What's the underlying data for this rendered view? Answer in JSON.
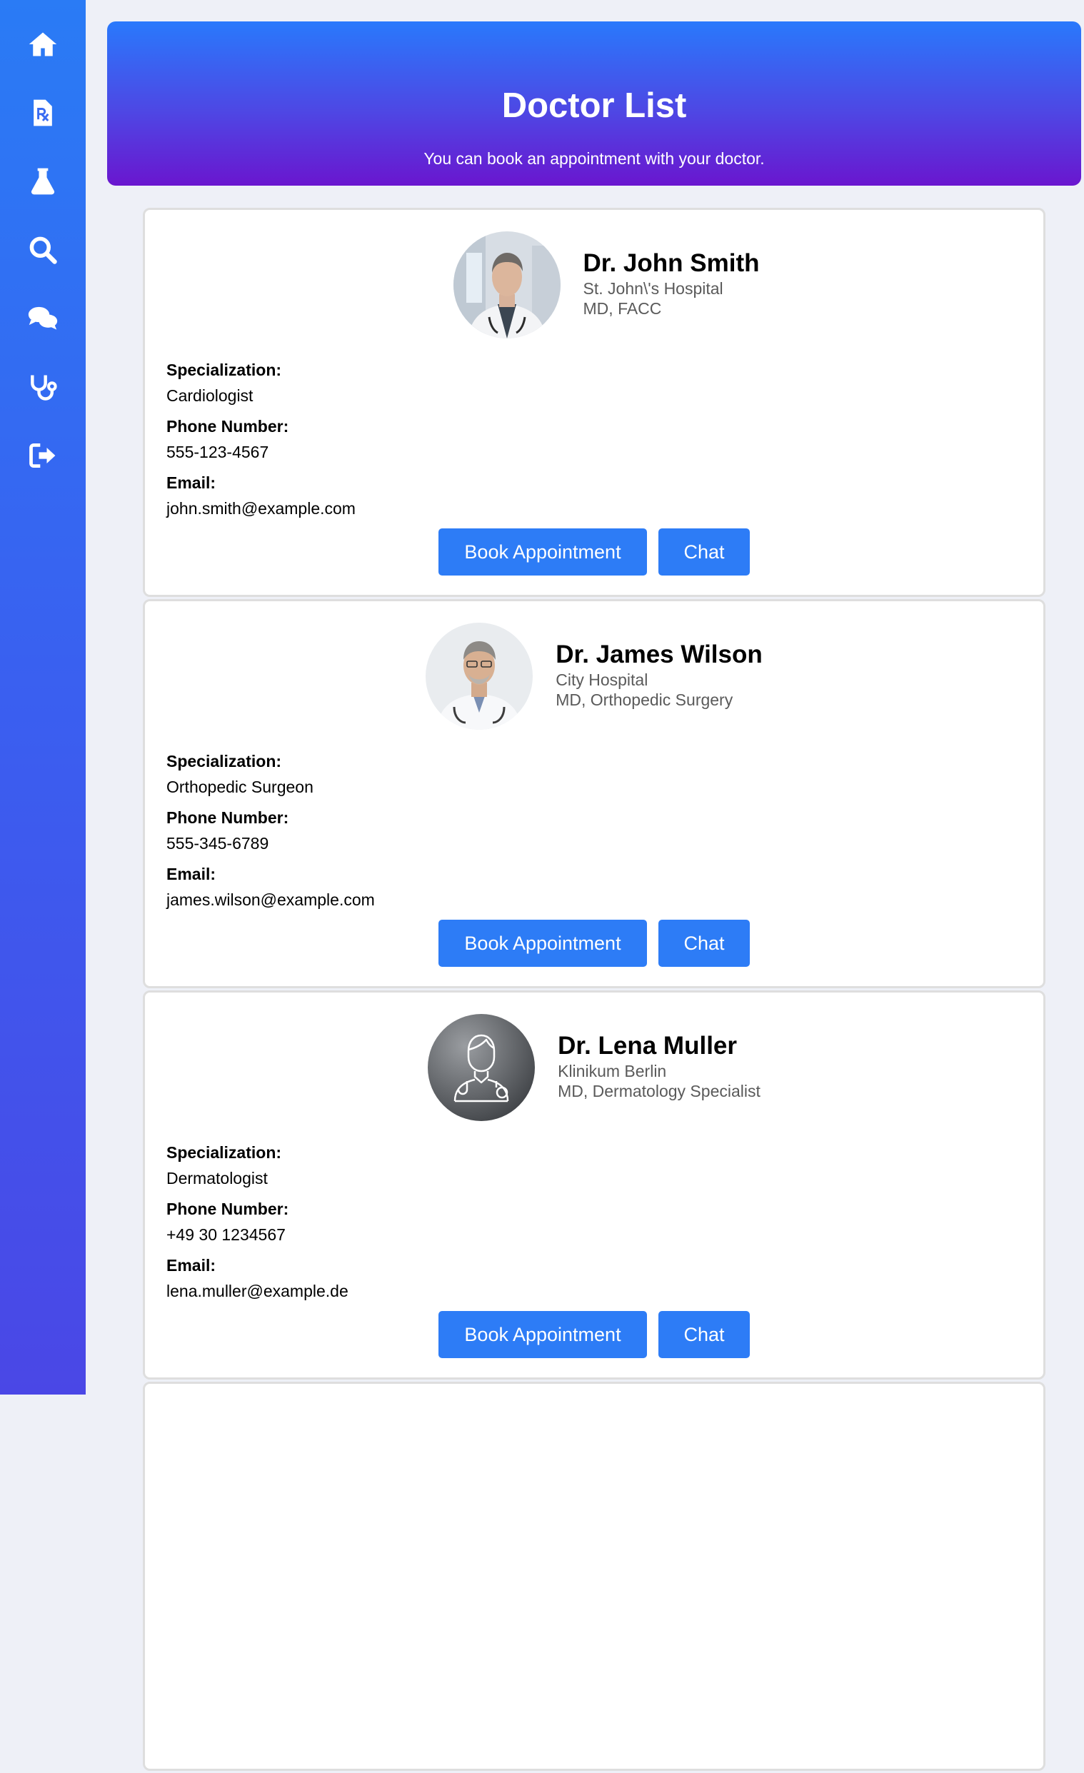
{
  "sidebar": {
    "items": [
      {
        "icon": "home-icon"
      },
      {
        "icon": "prescription-icon"
      },
      {
        "icon": "flask-icon"
      },
      {
        "icon": "search-icon"
      },
      {
        "icon": "comments-icon"
      },
      {
        "icon": "stethoscope-icon"
      },
      {
        "icon": "sign-out-icon"
      }
    ]
  },
  "header": {
    "title": "Doctor List",
    "subtitle": "You can book an appointment with your doctor."
  },
  "labels": {
    "specialization": "Specialization:",
    "phone": "Phone Number:",
    "email": "Email:",
    "book": "Book Appointment",
    "chat": "Chat"
  },
  "doctors": [
    {
      "name": "Dr. John Smith",
      "hospital": "St. John\\'s Hospital",
      "credentials": "MD, FACC",
      "specialization": "Cardiologist",
      "phone": "555-123-4567",
      "email": "john.smith@example.com"
    },
    {
      "name": "Dr. James Wilson",
      "hospital": "City Hospital",
      "credentials": "MD, Orthopedic Surgery",
      "specialization": "Orthopedic Surgeon",
      "phone": "555-345-6789",
      "email": "james.wilson@example.com"
    },
    {
      "name": "Dr. Lena Muller",
      "hospital": "Klinikum Berlin",
      "credentials": "MD, Dermatology Specialist",
      "specialization": "Dermatologist",
      "phone": "+49 30 1234567",
      "email": "lena.muller@example.de"
    }
  ],
  "colors": {
    "accent": "#2d7cf6",
    "header_top": "#2979fc",
    "header_bottom": "#6a16cf",
    "sidebar_top": "#2a7bf5",
    "sidebar_bottom": "#4a47e6"
  }
}
